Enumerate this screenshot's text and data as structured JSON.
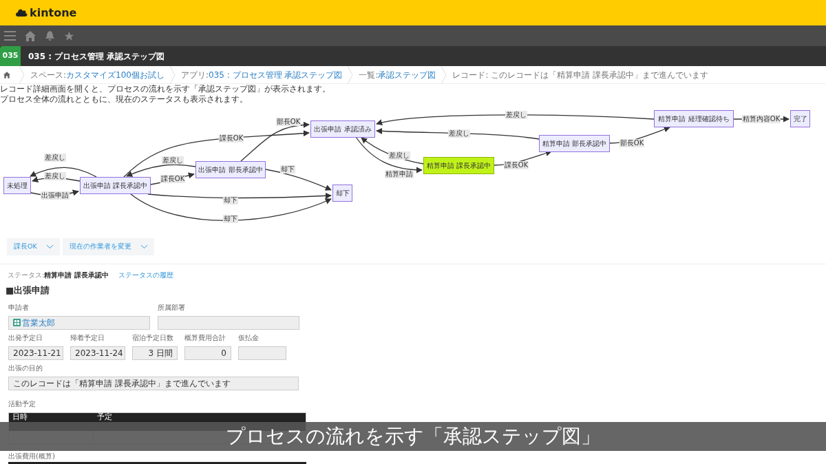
{
  "brand": {
    "name": "kintone"
  },
  "app": {
    "badge": "035",
    "title": "035 : プロセス管理 承認ステップ図"
  },
  "breadcrumb": [
    {
      "prefix": "スペース: ",
      "link": "カスタマイズ100個お試し"
    },
    {
      "prefix": "アプリ: ",
      "link": "035 : プロセス管理 承認ステップ図"
    },
    {
      "prefix": "一覧: ",
      "link": "承認ステップ図"
    },
    {
      "prefix": "レコード: このレコードは「精算申請 課長承認中」まで進んでいます"
    }
  ],
  "description": [
    "レコード詳細画面を開くと、プロセスの流れを示す「承認ステップ図」が表示されます。",
    "プロセス全体の流れとともに、現在のステータスも表示されます。"
  ],
  "diagram": {
    "nodes": [
      {
        "label": "未処理",
        "current": false
      },
      {
        "label": "出張申請 課長承認中",
        "current": false
      },
      {
        "label": "出張申請 部長承認中",
        "current": false
      },
      {
        "label": "出張申請 承認済み",
        "current": false
      },
      {
        "label": "却下",
        "current": false
      },
      {
        "label": "精算申請 課長承認中",
        "current": true
      },
      {
        "label": "精算申請 部長承認中",
        "current": false
      },
      {
        "label": "精算申請 経理確認待ち",
        "current": false
      },
      {
        "label": "完了",
        "current": false
      }
    ],
    "edges": [
      {
        "label": "差戻し"
      },
      {
        "label": "差戻し"
      },
      {
        "label": "出張申請"
      },
      {
        "label": "課長OK"
      },
      {
        "label": "差戻し"
      },
      {
        "label": "課長OK"
      },
      {
        "label": "部長OK"
      },
      {
        "label": "却下"
      },
      {
        "label": "却下"
      },
      {
        "label": "却下"
      },
      {
        "label": "精算申請"
      },
      {
        "label": "差戻し"
      },
      {
        "label": "課長OK"
      },
      {
        "label": "差戻し"
      },
      {
        "label": "部長OK"
      },
      {
        "label": "差戻し"
      },
      {
        "label": "精算内容OK"
      }
    ]
  },
  "actions": [
    "課長OK",
    "現在の作業者を変更"
  ],
  "status": {
    "label": "ステータス: ",
    "value": "精算申請 課長承認中",
    "history_link": "ステータスの履歴"
  },
  "section_title": "■出張申請",
  "fields_row1": [
    {
      "label": "申請者",
      "value": "営業太郎"
    },
    {
      "label": "所属部署"
    }
  ],
  "fields_row2": [
    {
      "label": "出発予定日",
      "value": "2023-11-21",
      "kind": "date"
    },
    {
      "label": "帰着予定日",
      "value": "2023-11-24",
      "kind": "date"
    },
    {
      "label": "宿泊予定日数",
      "value": "3 日間",
      "kind": "number"
    },
    {
      "label": "概算費用合計",
      "value": "0",
      "kind": "number"
    },
    {
      "label": "仮払金",
      "kind": "number"
    }
  ],
  "purpose": {
    "label": "出張の目的",
    "value": "このレコードは「精算申請 課長承認中」まで進んでいます"
  },
  "activity": {
    "label": "活動予定",
    "columns": [
      "日時",
      "予定"
    ]
  },
  "expense_label": "出張費用(概算)",
  "caption": "プロセスの流れを示す「承認ステップ図」"
}
